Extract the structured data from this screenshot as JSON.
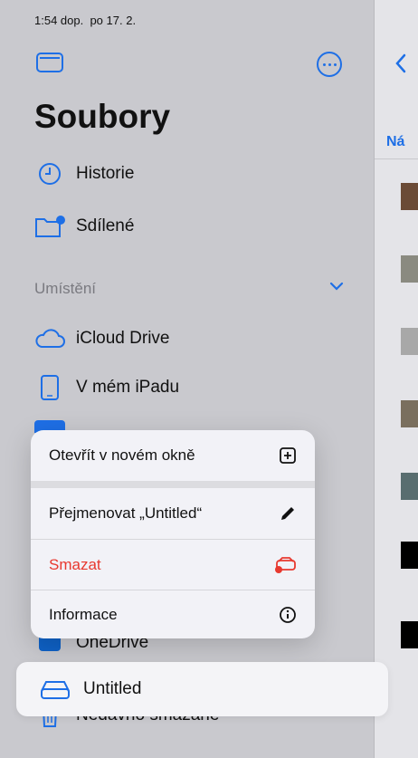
{
  "status": {
    "time": "1:54 dop.",
    "date": "po 17. 2."
  },
  "sidebar": {
    "title": "Soubory",
    "items": [
      {
        "label": "Historie",
        "icon": "clock-icon"
      },
      {
        "label": "Sdílené",
        "icon": "shared-folder-icon"
      }
    ],
    "section": {
      "label": "Umístění"
    },
    "locations": [
      {
        "label": "iCloud Drive",
        "icon": "cloud-icon"
      },
      {
        "label": "V mém iPadu",
        "icon": "ipad-icon"
      },
      {
        "label": "OneDrive",
        "icon": "onedrive-icon"
      },
      {
        "label": "Untitled",
        "icon": "drive-icon",
        "selected": true
      },
      {
        "label": "Nedávno smazané",
        "icon": "trash-icon"
      }
    ]
  },
  "detail": {
    "tab_label": "Ná"
  },
  "context_menu": {
    "items": [
      {
        "label": "Otevřít v novém okně",
        "icon": "new-window-icon"
      },
      {
        "label": "Přejmenovat „Untitled“",
        "icon": "pencil-icon"
      },
      {
        "label": "Smazat",
        "icon": "eject-drive-icon",
        "destructive": true
      },
      {
        "label": "Informace",
        "icon": "info-icon"
      }
    ]
  },
  "colors": {
    "accent": "#1e6fe6",
    "destructive": "#e8392f"
  }
}
